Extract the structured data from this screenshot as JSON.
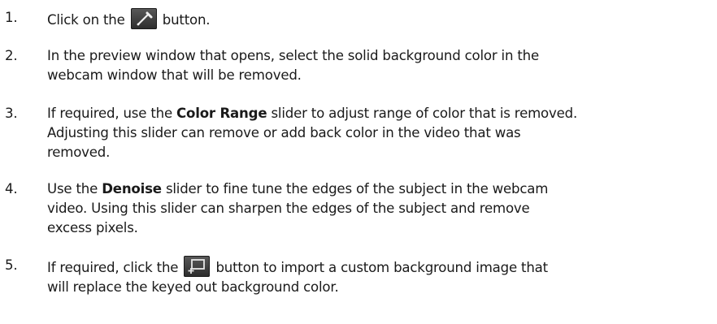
{
  "steps": [
    {
      "number": "1.",
      "pre": "Click on the",
      "icon": "eyedropper-icon",
      "post": "button."
    },
    {
      "number": "2.",
      "line1": "In the preview window that opens, select the solid background color in the",
      "line2": "webcam window that will be removed."
    },
    {
      "number": "3.",
      "pre": "If required, use the",
      "bold": "Color Range",
      "line1_post": "slider to adjust range of color that is removed.",
      "line2": "Adjusting this slider can remove or add back color in the video that was",
      "line3": "removed."
    },
    {
      "number": "4.",
      "pre": "Use the",
      "bold": "Denoise",
      "line1_post": "slider to fine tune the edges of the subject in the webcam",
      "line2": "video. Using this slider can sharpen the edges of the subject and remove",
      "line3": "excess pixels."
    },
    {
      "number": "5.",
      "pre": "If required, click the",
      "icon": "import-background-icon",
      "line1_post": "button to import a custom background image that",
      "line2": "will replace the keyed out background color."
    }
  ],
  "colors": {
    "text": "#1a1a1a",
    "button_top": "#5a5a5a",
    "button_bottom": "#2c2c2c",
    "icon_accent": "#e6e6e6"
  }
}
